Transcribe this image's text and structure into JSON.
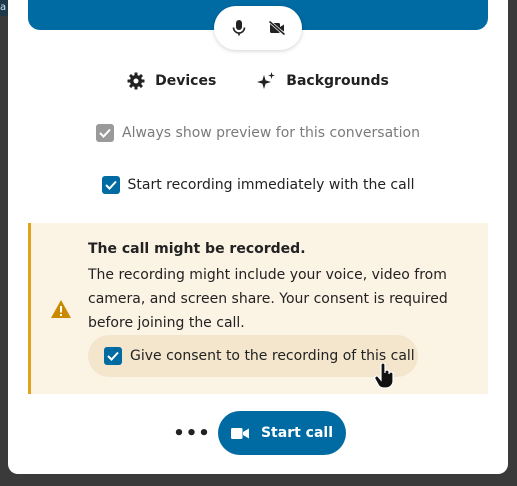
{
  "background": {
    "corner_char": "a"
  },
  "colors": {
    "primary": "#006aa3",
    "warning_border": "#e0a31c",
    "warning_bg": "#fbf3e4"
  },
  "media_controls": {
    "mic_icon": "microphone-icon",
    "camera_icon": "video-off-icon"
  },
  "settings": {
    "devices_label": "Devices",
    "backgrounds_label": "Backgrounds"
  },
  "options": {
    "always_preview_label": "Always show preview for this conversation",
    "always_preview_checked": true,
    "always_preview_disabled": true,
    "start_recording_label": "Start recording immediately with the call",
    "start_recording_checked": true
  },
  "warning": {
    "title": "The call might be recorded.",
    "text": "The recording might include your voice, video from camera, and screen share. Your consent is required before joining the call.",
    "consent_label": "Give consent to the recording of this call",
    "consent_checked": true
  },
  "footer": {
    "more_label": "•••",
    "start_call_label": "Start call"
  }
}
